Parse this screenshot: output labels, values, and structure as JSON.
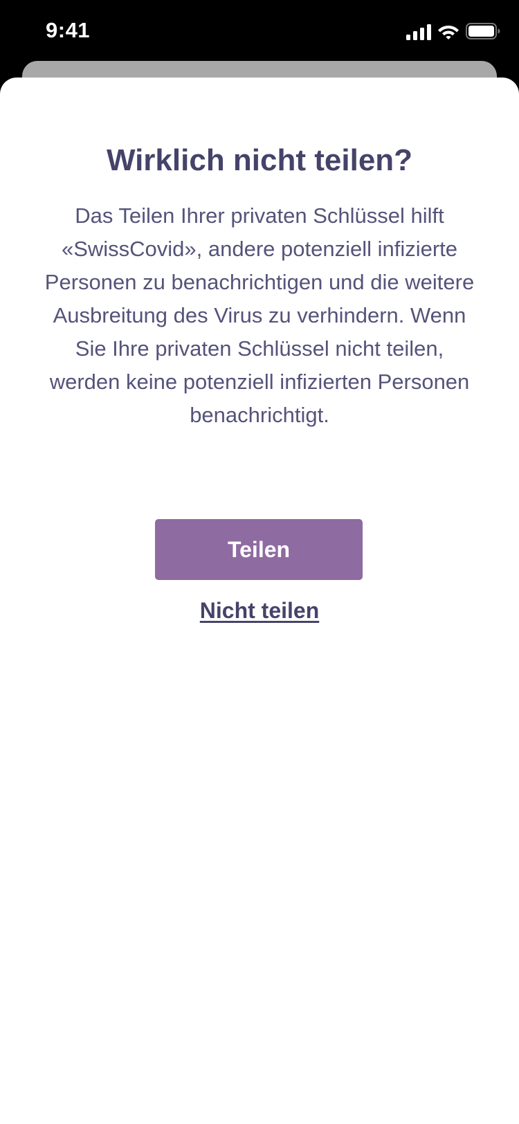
{
  "status_bar": {
    "time": "9:41",
    "icons": [
      "cellular-signal-icon",
      "wifi-icon",
      "battery-icon"
    ]
  },
  "dialog": {
    "title": "Wirklich nicht teilen?",
    "body": "Das Teilen Ihrer privaten Schlüssel hilft «SwissCovid», andere potenziell infizierte Personen zu benachrichtigen und die weitere Ausbreitung des Virus zu verhindern. Wenn Sie Ihre privaten Schlüssel nicht teilen, werden keine potenziell infizierten Personen benachrichtigt.",
    "share_button_label": "Teilen",
    "dont_share_label": "Nicht teilen"
  },
  "colors": {
    "title_text": "#45436a",
    "body_text": "#55537a",
    "primary_button": "#8e6ba1",
    "background": "#ffffff",
    "status_bar_bg": "#000000"
  }
}
